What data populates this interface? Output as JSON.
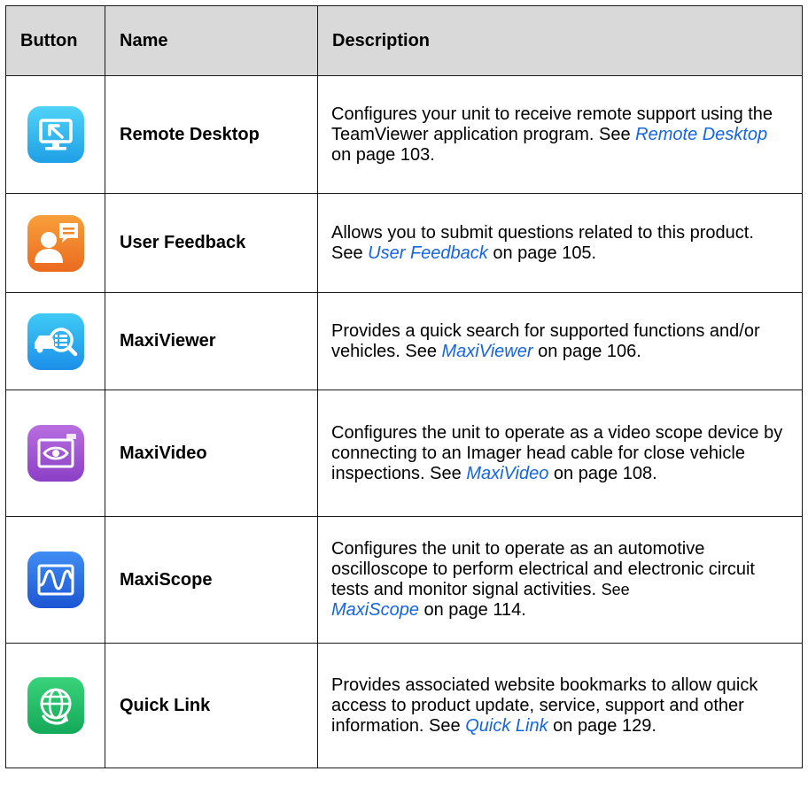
{
  "table": {
    "headers": [
      "Button",
      "Name",
      "Description"
    ],
    "rows": [
      {
        "icon": "remote-desktop-icon",
        "name": "Remote Desktop",
        "desc_pre": "Configures your unit to receive remote support using the TeamViewer application program. See ",
        "link": "Remote Desktop",
        "desc_post": " on page 103."
      },
      {
        "icon": "user-feedback-icon",
        "name": "User Feedback",
        "desc_pre": "Allows you to submit questions related to this product. See ",
        "link": "User Feedback",
        "desc_post": " on page 105."
      },
      {
        "icon": "maxiviewer-icon",
        "name": "MaxiViewer",
        "desc_pre": "Provides a quick search for supported functions and/or vehicles. See ",
        "link": "MaxiViewer",
        "desc_post": " on page 106."
      },
      {
        "icon": "maxivideo-icon",
        "name": "MaxiVideo",
        "desc_pre": "Configures the unit to operate as a video scope device by connecting to an Imager head cable for close vehicle inspections. See ",
        "link": "MaxiVideo",
        "desc_post": " on page 108."
      },
      {
        "icon": "maxiscope-icon",
        "name": "MaxiScope",
        "desc_pre": "Configures the unit to operate as an automotive oscilloscope to perform electrical and electronic circuit tests and monitor signal activities. ",
        "desc_see": "See",
        "link": "MaxiScope",
        "desc_post": " on page 114."
      },
      {
        "icon": "quick-link-icon",
        "name": "Quick Link",
        "desc_pre": "Provides associated website bookmarks to allow quick access to product update, service, support and other information. See ",
        "link": "Quick Link",
        "desc_post": " on page 129."
      }
    ]
  },
  "colors": {
    "header_bg": "#d9d9d9",
    "link": "#1565e0",
    "remote_desktop_icon": "#2aa9ee",
    "user_feedback_icon": "#f08a2c",
    "maxiviewer_icon": "#2bb0f0",
    "maxivideo_icon": "#a256d6",
    "maxiscope_icon": "#2c6fe6",
    "quick_link_icon": "#25be66"
  }
}
